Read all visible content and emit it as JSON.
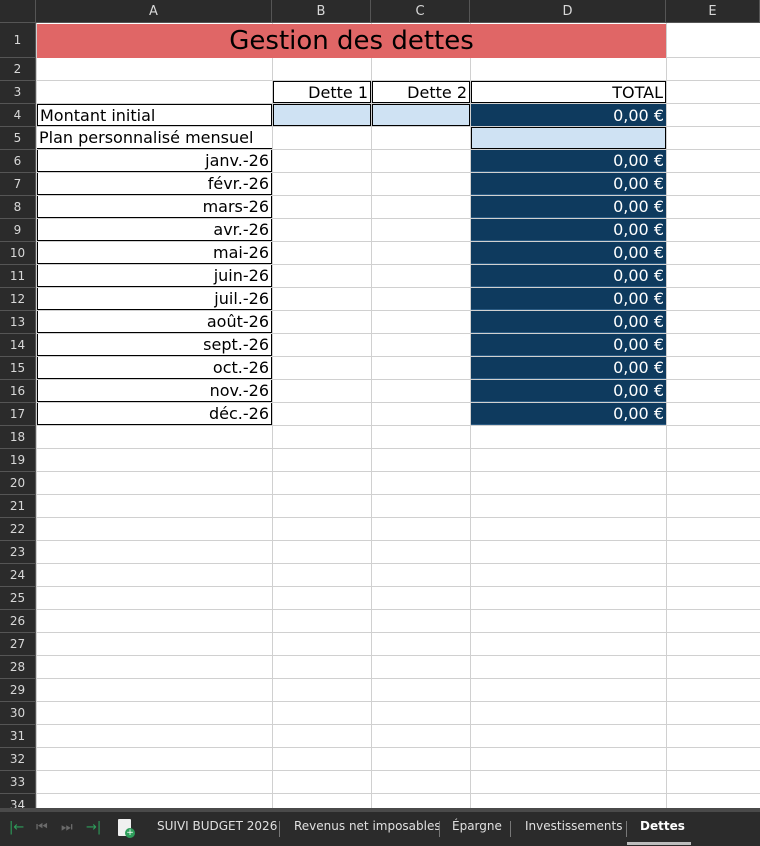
{
  "sheet": {
    "columns": [
      "A",
      "B",
      "C",
      "D",
      "E"
    ],
    "row_count": 35,
    "title": "Gestion des dettes",
    "headers": {
      "b": "Dette 1",
      "c": "Dette 2",
      "d": "TOTAL"
    },
    "labels": {
      "montant_initial": "Montant initial",
      "plan": "Plan personnalisé mensuel"
    },
    "montant_total": "0,00 €",
    "months": [
      {
        "label": "janv.-26",
        "total": "0,00 €"
      },
      {
        "label": "févr.-26",
        "total": "0,00 €"
      },
      {
        "label": "mars-26",
        "total": "0,00 €"
      },
      {
        "label": "avr.-26",
        "total": "0,00 €"
      },
      {
        "label": "mai-26",
        "total": "0,00 €"
      },
      {
        "label": "juin-26",
        "total": "0,00 €"
      },
      {
        "label": "juil.-26",
        "total": "0,00 €"
      },
      {
        "label": "août-26",
        "total": "0,00 €"
      },
      {
        "label": "sept.-26",
        "total": "0,00 €"
      },
      {
        "label": "oct.-26",
        "total": "0,00 €"
      },
      {
        "label": "nov.-26",
        "total": "0,00 €"
      },
      {
        "label": "déc.-26",
        "total": "0,00 €"
      }
    ],
    "colors": {
      "title_bg": "#e06666",
      "navy": "#0e3a5e",
      "light_blue": "#cfe2f3"
    }
  },
  "tabs": {
    "items": [
      {
        "label": "SUIVI BUDGET 2026"
      },
      {
        "label": "Revenus net imposables"
      },
      {
        "label": "Épargne"
      },
      {
        "label": "Investissements"
      },
      {
        "label": "Dettes"
      }
    ],
    "active": "Dettes",
    "icons": [
      "first-sheet-icon",
      "prev-sheet-icon",
      "next-sheet-icon",
      "last-sheet-icon",
      "add-sheet-icon"
    ]
  }
}
